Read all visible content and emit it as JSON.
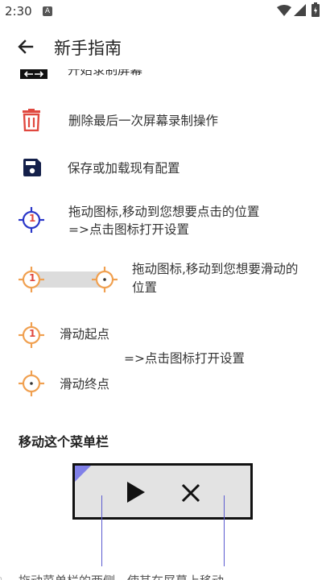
{
  "status_bar": {
    "time": "2:30",
    "notification_badge": "A",
    "icons": [
      "wifi-icon",
      "signal-icon",
      "battery-icon"
    ]
  },
  "app_bar": {
    "title": "新手指南",
    "back_icon": "arrow-left-icon"
  },
  "guide_items": {
    "start_record": "开始录制屏幕",
    "delete_last": "删除最后一次屏幕录制操作",
    "save_load": "保存或加载现有配置",
    "tap_target_line1": "拖动图标,移动到您想要点击的位置",
    "tap_target_line2": "=>点击图标打开设置",
    "swipe_line1": "拖动图标,移动到您想要滑动的",
    "swipe_line2": "位置",
    "swipe_start_label": "滑动起点",
    "swipe_end_label": "滑动终点",
    "swipe_settings": "=>点击图标打开设置",
    "target_number": "1"
  },
  "menu_section": {
    "title": "移动这个菜单栏",
    "footer_text": "拖动菜单栏的两侧，使其在屏幕上移动"
  },
  "colors": {
    "red": "#e0483f",
    "navy": "#14204a",
    "blue_target": "#2a37c8",
    "orange_target": "#f0a050",
    "corner": "#8080e8"
  }
}
